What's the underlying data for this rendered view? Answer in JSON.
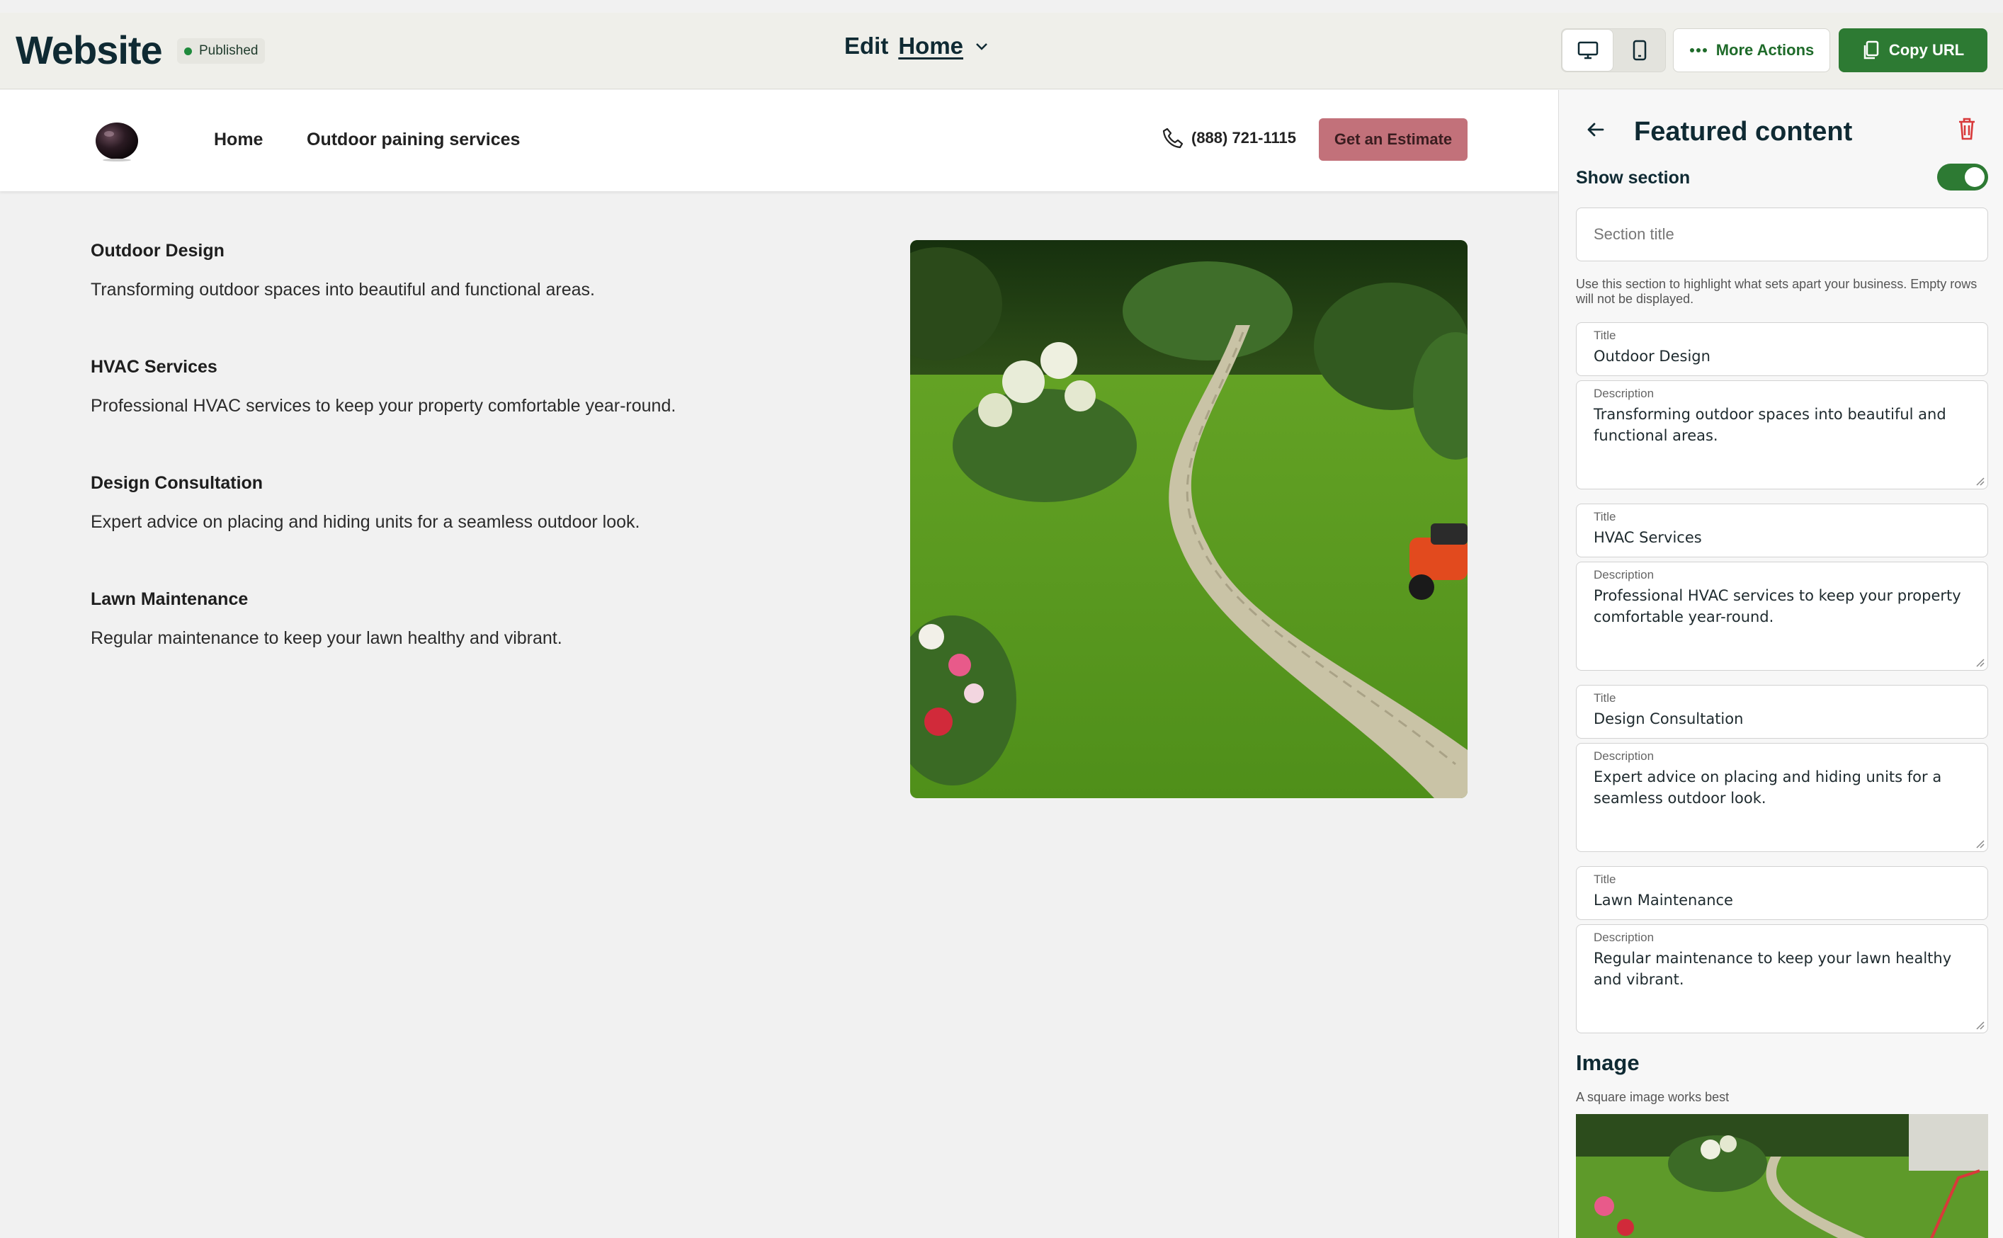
{
  "topbar": {
    "brand": "Website",
    "status": "Published",
    "edit_label": "Edit",
    "page_name": "Home",
    "more_actions": "More Actions",
    "copy_url": "Copy URL"
  },
  "site": {
    "nav": [
      "Home",
      "Outdoor paining services"
    ],
    "phone": "(888) 721-1115",
    "cta": "Get an Estimate",
    "features": [
      {
        "title": "Outdoor Design",
        "description": "Transforming outdoor spaces into beautiful and functional areas."
      },
      {
        "title": "HVAC Services",
        "description": "Professional HVAC services to keep your property comfortable year-round."
      },
      {
        "title": "Design Consultation",
        "description": "Expert advice on placing and hiding units for a seamless outdoor look."
      },
      {
        "title": "Lawn Maintenance",
        "description": "Regular maintenance to keep your lawn healthy and vibrant."
      }
    ]
  },
  "panel": {
    "heading": "Featured content",
    "show_section": "Show section",
    "section_title_placeholder": "Section title",
    "help": "Use this section to highlight what sets apart your business. Empty rows will not be displayed.",
    "title_label": "Title",
    "description_label": "Description",
    "image_heading": "Image",
    "image_hint": "A square image works best"
  },
  "colors": {
    "accent_green": "#2d7a33",
    "cta_pink": "#c2717a",
    "trash_red": "#d8393a",
    "brand_dark": "#0f2a33"
  }
}
